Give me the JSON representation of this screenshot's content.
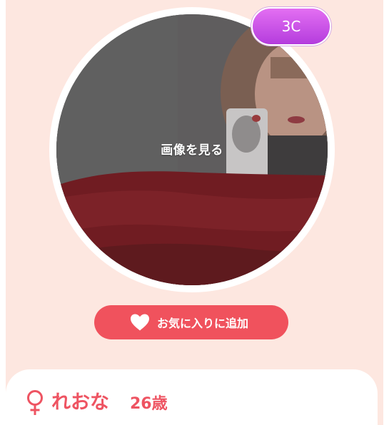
{
  "photo": {
    "view_label": "画像を見る"
  },
  "badge": {
    "label": "3C",
    "color_top": "#e36ff2",
    "color_bottom": "#b43cdd"
  },
  "favorite_button": {
    "label": "お気に入りに追加",
    "icon": "heart-icon",
    "color": "#f0525d"
  },
  "profile": {
    "gender_icon": "female-symbol-icon",
    "name": "れおな",
    "age": "26歳",
    "accent_color": "#ee5462"
  },
  "background_color": "#fde7e0"
}
